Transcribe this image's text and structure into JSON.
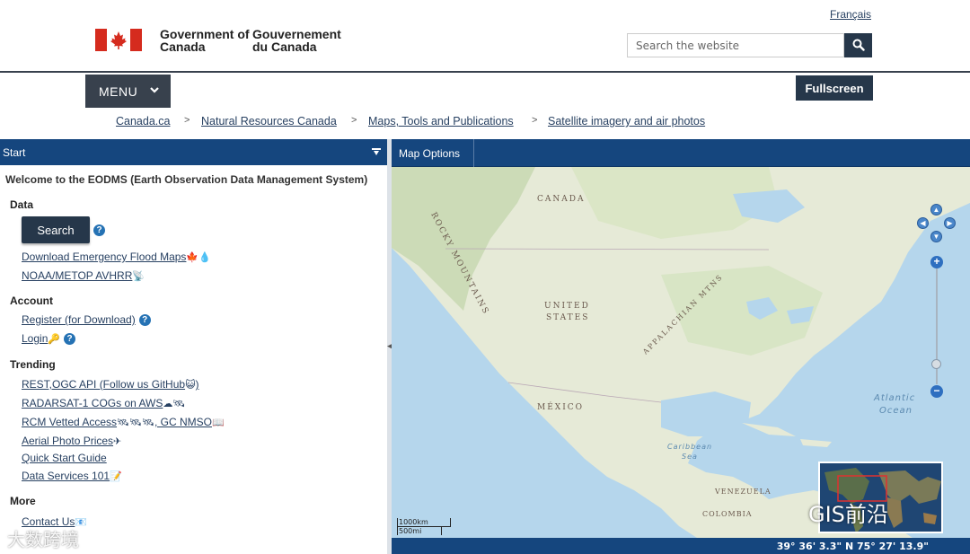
{
  "header": {
    "gov_en": "Government of Canada",
    "gov_fr": "Gouvernement du Canada",
    "lang_link": "Français",
    "search_placeholder": "Search the website",
    "menu_label": "MENU",
    "fullscreen_label": "Fullscreen"
  },
  "breadcrumb": [
    "Canada.ca",
    "Natural Resources Canada",
    "Maps, Tools and Publications",
    "Satellite imagery and air photos"
  ],
  "left_panel": {
    "title": "Start",
    "welcome": "Welcome to the EODMS (Earth Observation Data Management System)",
    "sections": {
      "data": "Data",
      "account": "Account",
      "trending": "Trending",
      "more": "More"
    },
    "search_button": "Search",
    "data_links": [
      "Download Emergency Flood Maps",
      "NOAA/METOP AVHRR"
    ],
    "account_links": [
      "Register (for Download)",
      "Login"
    ],
    "trending_links": [
      "REST,OGC API (Follow us GitHub",
      ")",
      "RADARSAT-1 COGs on AWS",
      "RCM Vetted Access",
      ", GC NMSO",
      "Aerial Photo Prices",
      "Quick Start Guide",
      "Data Services 101"
    ],
    "more_links": [
      "Contact Us"
    ]
  },
  "map": {
    "tab": "Map Options",
    "coords": "39° 36' 3.3\" N 75° 27' 13.9\"",
    "labels": {
      "canada": "CANADA",
      "rocky": "ROCKY MOUNTAINS",
      "us1": "UNITED",
      "us2": "STATES",
      "appalachian": "APPALACHIAN MTNS",
      "mexico": "MÉXICO",
      "atlantic1": "Atlantic",
      "atlantic2": "Ocean",
      "caribbean1": "Caribbean",
      "caribbean2": "Sea",
      "venezuela": "VENEZUELA",
      "colombia": "COLOMBIA"
    },
    "scale_km": "1000km",
    "scale_mi": "500mi"
  },
  "watermarks": {
    "left": "大数跨境",
    "right": "GIS前沿"
  },
  "colors": {
    "header_bar": "#15467e",
    "button_dark": "#26374a",
    "link": "#284162",
    "flag_red": "#d52b1e"
  }
}
